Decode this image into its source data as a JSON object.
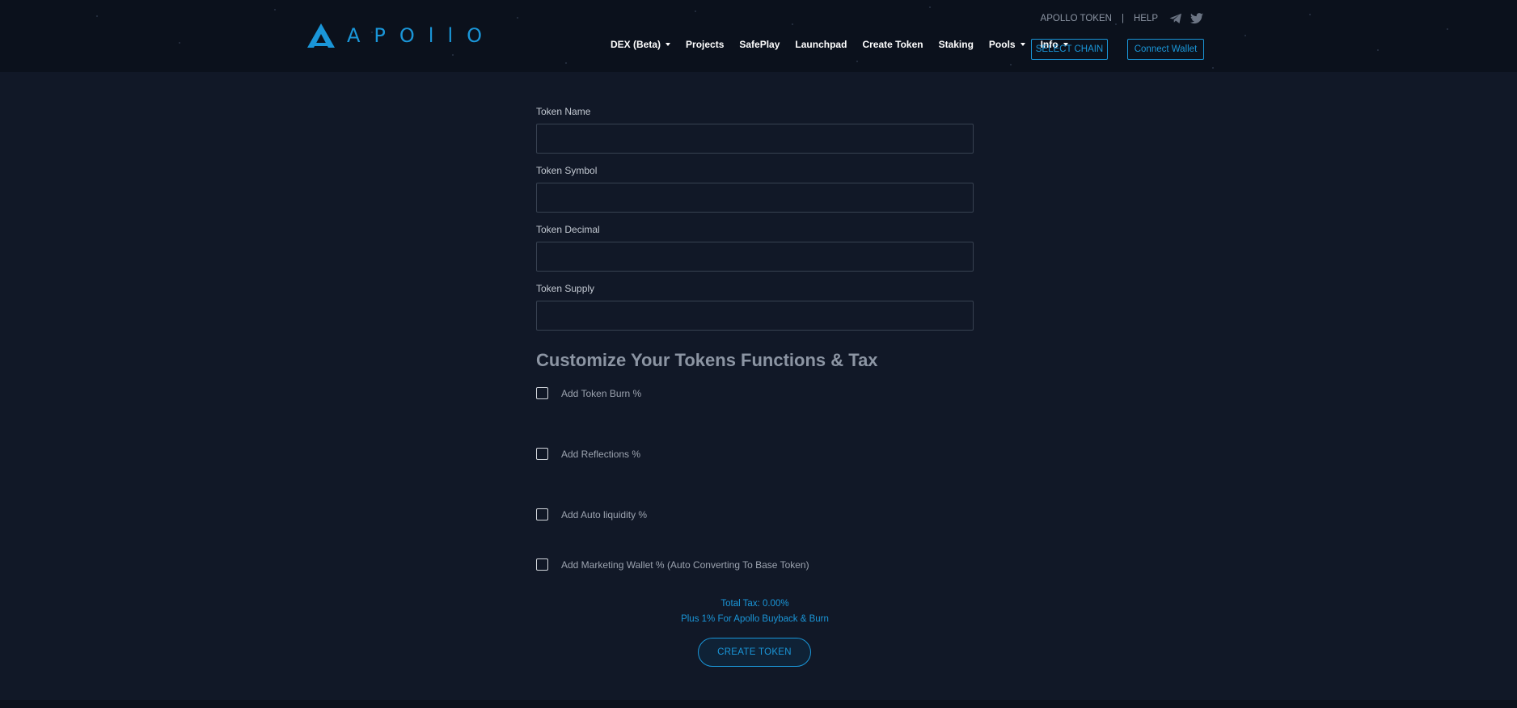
{
  "brand": {
    "logo_text": "APOllO",
    "accent_color": "#1a96d8"
  },
  "top_links": {
    "token": "APOLLO TOKEN",
    "separator": "|",
    "help": "HELP",
    "social_icons": [
      "telegram-icon",
      "twitter-icon"
    ]
  },
  "nav": {
    "items": [
      {
        "label": "DEX (Beta)",
        "dropdown": true
      },
      {
        "label": "Projects",
        "dropdown": false
      },
      {
        "label": "SafePlay",
        "dropdown": false
      },
      {
        "label": "Launchpad",
        "dropdown": false
      },
      {
        "label": "Create Token",
        "dropdown": false
      },
      {
        "label": "Staking",
        "dropdown": false
      },
      {
        "label": "Pools",
        "dropdown": true
      },
      {
        "label": "Info",
        "dropdown": true
      }
    ],
    "select_chain": "SELECT CHAIN",
    "connect_wallet": "Connect Wallet"
  },
  "form": {
    "fields": [
      {
        "label": "Token Name",
        "value": ""
      },
      {
        "label": "Token Symbol",
        "value": ""
      },
      {
        "label": "Token Decimal",
        "value": ""
      },
      {
        "label": "Token Supply",
        "value": ""
      }
    ]
  },
  "customize": {
    "title": "Customize Your Tokens Functions & Tax",
    "options": [
      {
        "label": "Add Token Burn %",
        "checked": false
      },
      {
        "label": "Add Reflections %",
        "checked": false
      },
      {
        "label": "Add Auto liquidity %",
        "checked": false
      },
      {
        "label": "Add Marketing Wallet % (Auto Converting To Base Token)",
        "checked": false
      }
    ]
  },
  "tax": {
    "total": "Total Tax: 0.00%",
    "note": "Plus 1% For Apollo Buyback & Burn"
  },
  "create_button": "CREATE TOKEN"
}
